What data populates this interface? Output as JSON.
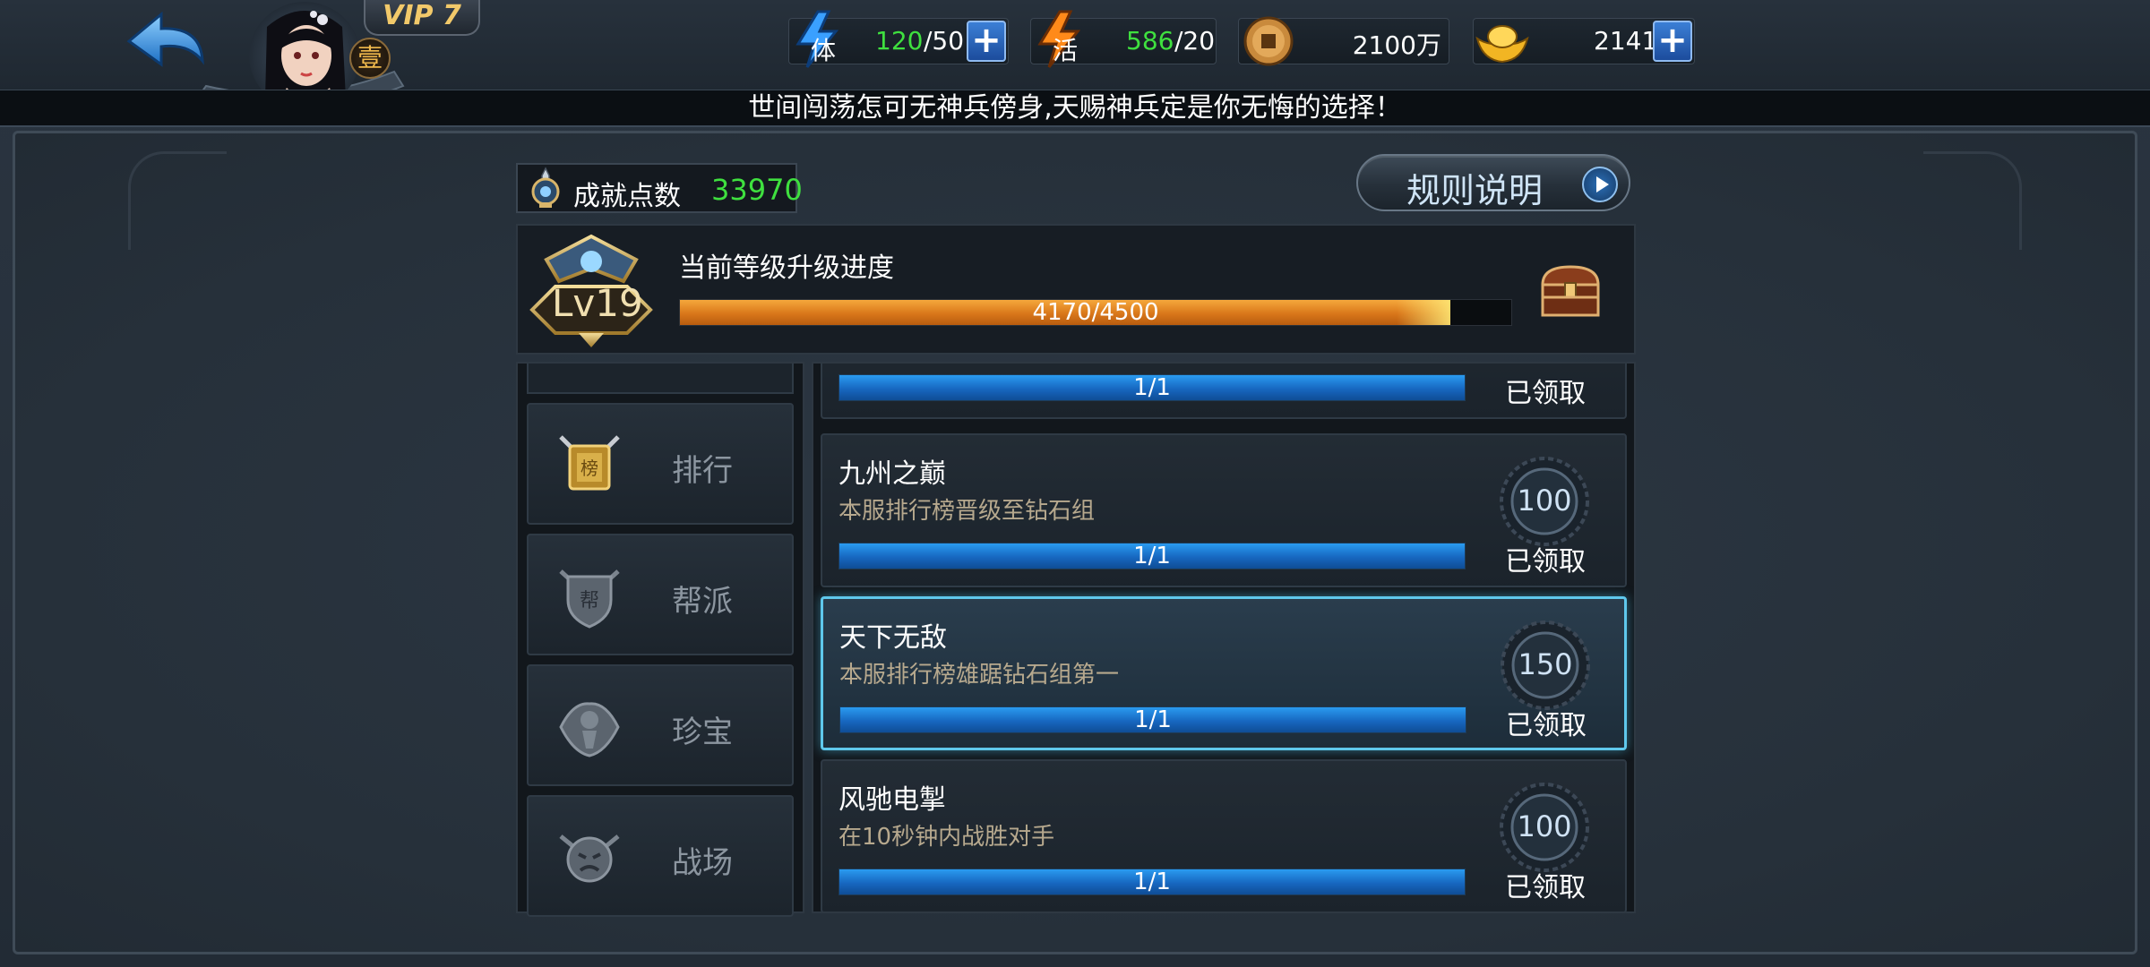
{
  "header": {
    "vip_label": "VIP 7",
    "rank_badge": "壹",
    "stamina": {
      "icon_char": "体",
      "current": "120",
      "max": "/50"
    },
    "vitality": {
      "icon_char": "活",
      "current": "586",
      "max": "/20"
    },
    "coins": {
      "value": "2100万"
    },
    "gold": {
      "value": "2141"
    }
  },
  "ticker": "世间闯荡怎可无神兵傍身,天赐神兵定是你无悔的选择！",
  "points": {
    "label": "成就点数",
    "value": "33970"
  },
  "rules_button": "规则说明",
  "level": {
    "label": "Lv19",
    "title": "当前等级升级进度",
    "progress_text": "4170/4500",
    "progress_fraction": 0.9267
  },
  "tabs": [
    {
      "label": "排行",
      "active": true
    },
    {
      "label": "帮派",
      "active": false
    },
    {
      "label": "珍宝",
      "active": false
    },
    {
      "label": "战场",
      "active": false
    }
  ],
  "achievements": [
    {
      "title": "",
      "desc": "",
      "progress_text": "1/1",
      "progress_fraction": 1,
      "reward": "",
      "status": "已领取"
    },
    {
      "title": "九州之巅",
      "desc": "本服排行榜晋级至钻石组",
      "progress_text": "1/1",
      "progress_fraction": 1,
      "reward": "100",
      "status": "已领取"
    },
    {
      "title": "天下无敌",
      "desc": "本服排行榜雄踞钻石组第一",
      "progress_text": "1/1",
      "progress_fraction": 1,
      "reward": "150",
      "status": "已领取",
      "selected": true
    },
    {
      "title": "风驰电掣",
      "desc": "在10秒钟内战胜对手",
      "progress_text": "1/1",
      "progress_fraction": 1,
      "reward": "100",
      "status": "已领取"
    }
  ],
  "colors": {
    "points_green": "#3fe03f",
    "stamina_green": "#3fe03f",
    "accent_cyan": "#5fc8ec",
    "progress_orange": "#e08a22",
    "progress_blue": "#1f80d8"
  }
}
